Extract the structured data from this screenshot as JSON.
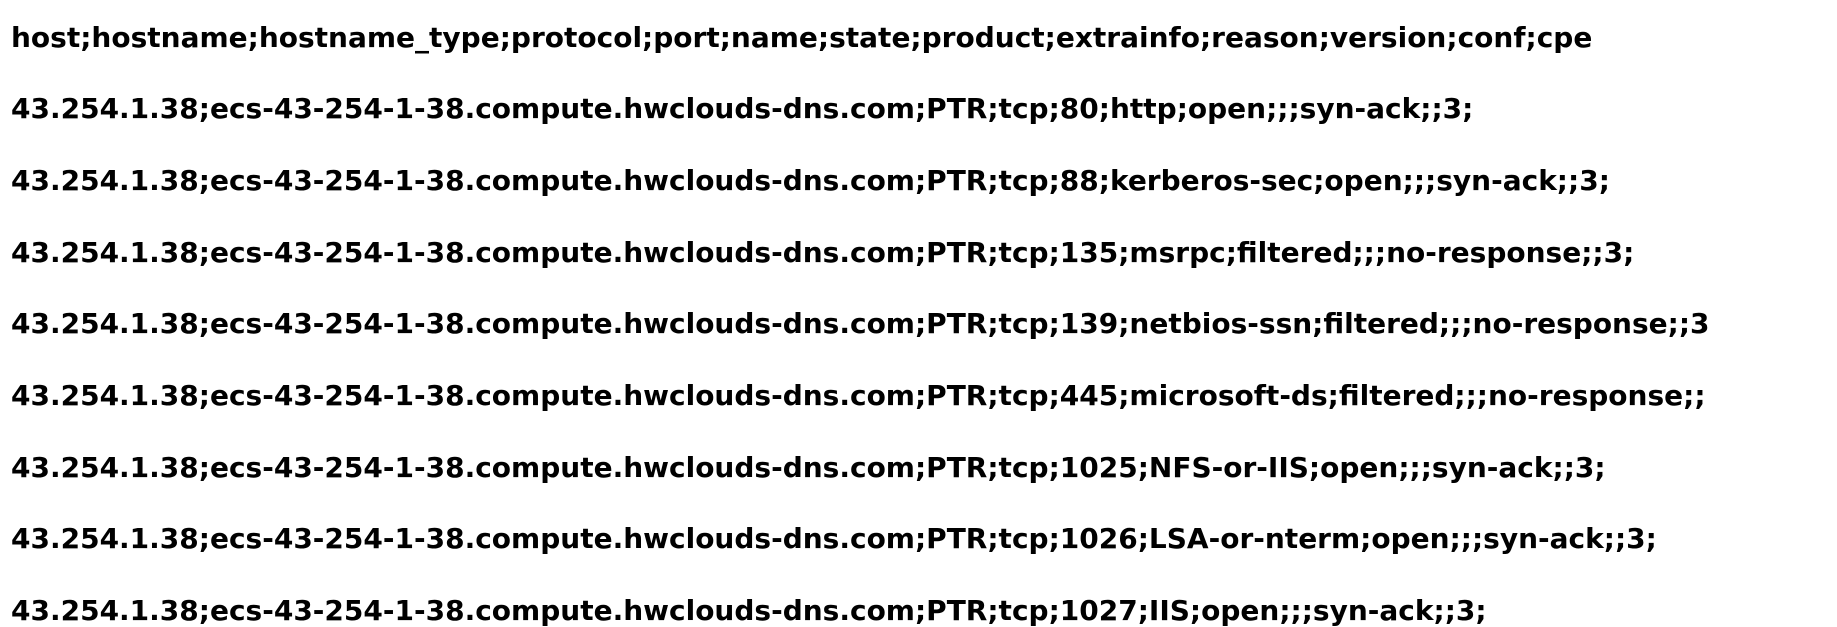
{
  "document": {
    "lines": [
      "host;hostname;hostname_type;protocol;port;name;state;product;extrainfo;reason;version;conf;cpe",
      "43.254.1.38;ecs-43-254-1-38.compute.hwclouds-dns.com;PTR;tcp;80;http;open;;;syn-ack;;3;",
      "43.254.1.38;ecs-43-254-1-38.compute.hwclouds-dns.com;PTR;tcp;88;kerberos-sec;open;;;syn-ack;;3;",
      "43.254.1.38;ecs-43-254-1-38.compute.hwclouds-dns.com;PTR;tcp;135;msrpc;filtered;;;no-response;;3;",
      "43.254.1.38;ecs-43-254-1-38.compute.hwclouds-dns.com;PTR;tcp;139;netbios-ssn;filtered;;;no-response;;3",
      "43.254.1.38;ecs-43-254-1-38.compute.hwclouds-dns.com;PTR;tcp;445;microsoft-ds;filtered;;;no-response;;",
      "43.254.1.38;ecs-43-254-1-38.compute.hwclouds-dns.com;PTR;tcp;1025;NFS-or-IIS;open;;;syn-ack;;3;",
      "43.254.1.38;ecs-43-254-1-38.compute.hwclouds-dns.com;PTR;tcp;1026;LSA-or-nterm;open;;;syn-ack;;3;",
      "43.254.1.38;ecs-43-254-1-38.compute.hwclouds-dns.com;PTR;tcp;1027;IIS;open;;;syn-ack;;3;"
    ]
  }
}
